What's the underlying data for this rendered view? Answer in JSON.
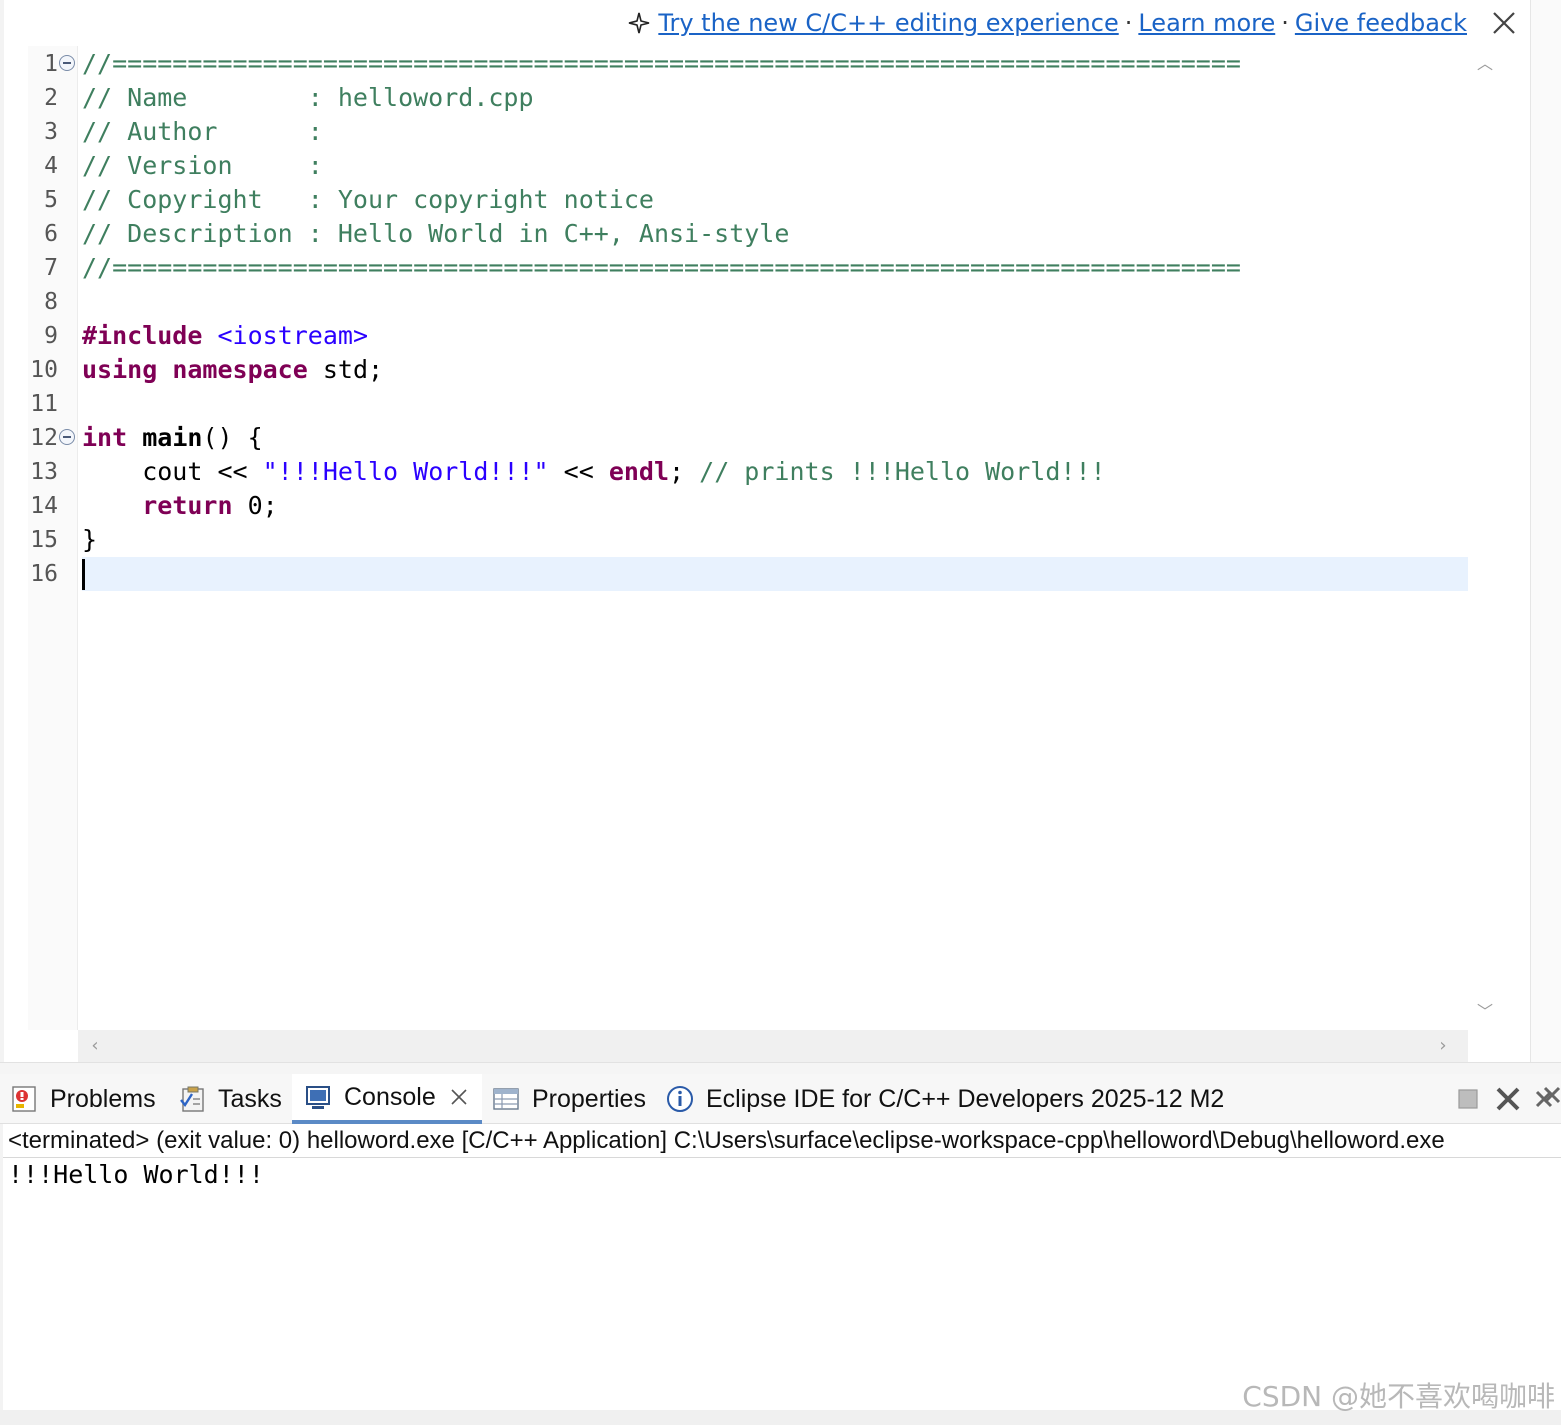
{
  "banner": {
    "try_link": "Try the new C/C++ editing experience",
    "sep1": "·",
    "learn_more": "Learn more",
    "sep2": "·",
    "give_feedback": "Give feedback"
  },
  "editor": {
    "lines": [
      {
        "num": "1",
        "tokens": [
          {
            "t": "//===========================================================================",
            "c": "cmt"
          }
        ]
      },
      {
        "num": "2",
        "tokens": [
          {
            "t": "// Name        : helloword.cpp",
            "c": "cmt"
          }
        ]
      },
      {
        "num": "3",
        "tokens": [
          {
            "t": "// Author      :",
            "c": "cmt"
          }
        ]
      },
      {
        "num": "4",
        "tokens": [
          {
            "t": "// Version     :",
            "c": "cmt"
          }
        ]
      },
      {
        "num": "5",
        "tokens": [
          {
            "t": "// Copyright   : Your copyright notice",
            "c": "cmt"
          }
        ]
      },
      {
        "num": "6",
        "tokens": [
          {
            "t": "// Description : Hello World in C++, Ansi-style",
            "c": "cmt"
          }
        ]
      },
      {
        "num": "7",
        "tokens": [
          {
            "t": "//===========================================================================",
            "c": "cmt"
          }
        ]
      },
      {
        "num": "8",
        "tokens": []
      },
      {
        "num": "9",
        "tokens": [
          {
            "t": "#include",
            "c": "kw"
          },
          {
            "t": " ",
            "c": "plain"
          },
          {
            "t": "<iostream>",
            "c": "inc"
          }
        ]
      },
      {
        "num": "10",
        "tokens": [
          {
            "t": "using",
            "c": "kw"
          },
          {
            "t": " ",
            "c": "plain"
          },
          {
            "t": "namespace",
            "c": "kw"
          },
          {
            "t": " std;",
            "c": "plain"
          }
        ]
      },
      {
        "num": "11",
        "tokens": []
      },
      {
        "num": "12",
        "tokens": [
          {
            "t": "int",
            "c": "kw"
          },
          {
            "t": " ",
            "c": "plain"
          },
          {
            "t": "main",
            "c": "plainb"
          },
          {
            "t": "() {",
            "c": "plain"
          }
        ]
      },
      {
        "num": "13",
        "tokens": [
          {
            "t": "    cout << ",
            "c": "plain"
          },
          {
            "t": "\"!!!Hello World!!!\"",
            "c": "str"
          },
          {
            "t": " << ",
            "c": "plain"
          },
          {
            "t": "endl",
            "c": "kw"
          },
          {
            "t": "; ",
            "c": "plain"
          },
          {
            "t": "// prints !!!Hello World!!!",
            "c": "cmt"
          }
        ]
      },
      {
        "num": "14",
        "tokens": [
          {
            "t": "    ",
            "c": "plain"
          },
          {
            "t": "return",
            "c": "kw"
          },
          {
            "t": " 0;",
            "c": "plain"
          }
        ]
      },
      {
        "num": "15",
        "tokens": [
          {
            "t": "}",
            "c": "plain"
          }
        ]
      },
      {
        "num": "16",
        "tokens": []
      }
    ],
    "fold_lines": [
      "1",
      "12"
    ]
  },
  "panel": {
    "tabs": {
      "problems": "Problems",
      "tasks": "Tasks",
      "console": "Console",
      "properties": "Properties",
      "about": "Eclipse IDE for C/C++ Developers 2025-12 M2"
    },
    "console_status": "<terminated> (exit value: 0) helloword.exe [C/C++ Application] C:\\Users\\surface\\eclipse-workspace-cpp\\helloword\\Debug\\helloword.exe",
    "console_output": "!!!Hello World!!!"
  },
  "watermark": "CSDN @她不喜欢喝咖啡",
  "colors": {
    "comment": "#3f7f5f",
    "keyword": "#7f0055",
    "string": "#2a00ff",
    "link": "#1a63c6",
    "current_line": "#e8f2fe"
  }
}
